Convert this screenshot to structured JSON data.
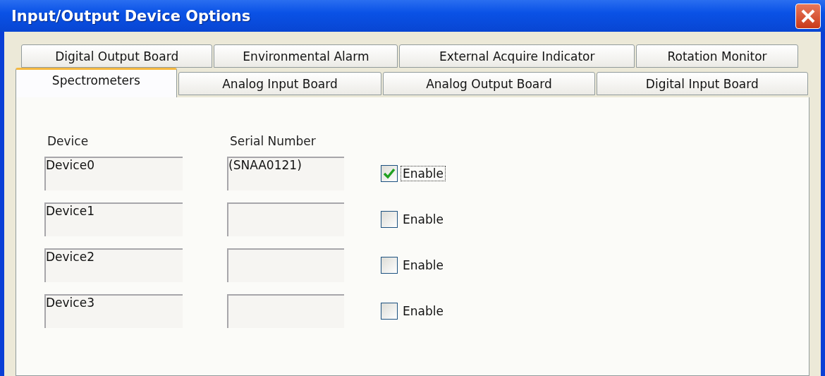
{
  "window": {
    "title": "Input/Output Device Options"
  },
  "tab_rows": [
    {
      "tabs": [
        {
          "label": "Digital Output Board",
          "selected": false
        },
        {
          "label": "Environmental Alarm",
          "selected": false
        },
        {
          "label": "External Acquire Indicator",
          "selected": false
        },
        {
          "label": "Rotation Monitor",
          "selected": false
        }
      ]
    },
    {
      "tabs": [
        {
          "label": "Spectrometers",
          "selected": true
        },
        {
          "label": "Analog Input Board",
          "selected": false
        },
        {
          "label": "Analog Output Board",
          "selected": false
        },
        {
          "label": "Digital Input Board",
          "selected": false
        }
      ]
    }
  ],
  "columns": [
    "Device",
    "Serial Number"
  ],
  "devices": [
    {
      "device": "Device0",
      "serial": "(SNAA0121)",
      "enable_label": "Enable",
      "checked": true,
      "focused": true
    },
    {
      "device": "Device1",
      "enable_label": "Enable",
      "checked": false,
      "focused": false
    },
    {
      "device": "Device2",
      "enable_label": "Enable",
      "checked": false,
      "focused": false
    },
    {
      "device": "Device3",
      "enable_label": "Enable",
      "checked": false,
      "focused": false
    }
  ]
}
